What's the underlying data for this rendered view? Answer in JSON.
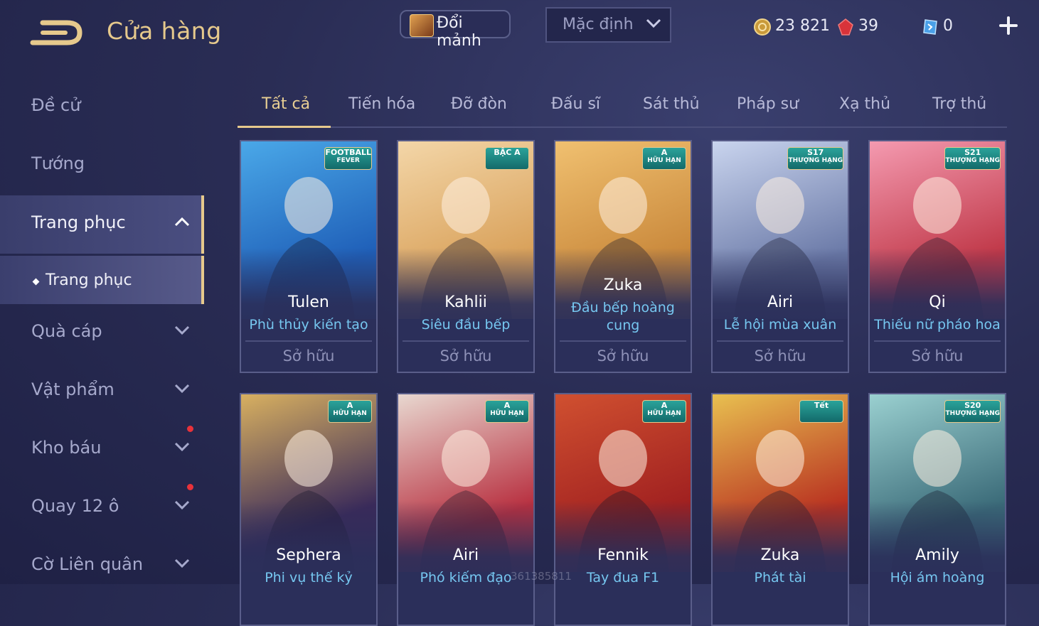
{
  "header": {
    "title": "Cửa hàng",
    "exchange_label": "Đổi mảnh",
    "sort_label": "Mặc định",
    "currencies": [
      {
        "icon": "gold-coin-icon",
        "value": "23 821"
      },
      {
        "icon": "red-gem-icon",
        "value": "39"
      },
      {
        "icon": "blue-voucher-icon",
        "value": "0"
      }
    ]
  },
  "sidebar": {
    "items": [
      {
        "label": "Đề cử"
      },
      {
        "label": "Tướng"
      },
      {
        "label": "Trang phục"
      },
      {
        "label": "Trang phục"
      },
      {
        "label": "Quà cáp"
      },
      {
        "label": "Vật phẩm"
      },
      {
        "label": "Kho báu"
      },
      {
        "label": "Quay 12 ô"
      },
      {
        "label": "Cờ Liên quân"
      }
    ]
  },
  "tabs": [
    "Tất cả",
    "Tiến hóa",
    "Đỡ đòn",
    "Đấu sĩ",
    "Sát thủ",
    "Pháp sư",
    "Xạ thủ",
    "Trợ thủ"
  ],
  "cards": [
    {
      "hero": "Tulen",
      "skin": "Phù thủy kiến tạo",
      "status": "Sở hữu",
      "badge_top": "FOOTBALL",
      "badge_bottom": "FEVER",
      "art_colors": [
        "#1f5fb8",
        "#4aa8e8"
      ]
    },
    {
      "hero": "Kahlii",
      "skin": "Siêu đầu bếp",
      "status": "Sở hữu",
      "badge_top": "BẬC A",
      "badge_bottom": "",
      "art_colors": [
        "#d9a15a",
        "#f3d6a8"
      ]
    },
    {
      "hero": "Zuka",
      "skin": "Đầu bếp hoàng cung",
      "status": "Sở hữu",
      "badge_top": "A",
      "badge_bottom": "HỮU HẠN",
      "art_colors": [
        "#c9883b",
        "#f0c070"
      ]
    },
    {
      "hero": "Airi",
      "skin": "Lễ hội mùa xuân",
      "status": "Sở hữu",
      "badge_top": "S17",
      "badge_bottom": "THƯỢNG HẠNG",
      "art_colors": [
        "#6b7aa8",
        "#c9d4ee"
      ]
    },
    {
      "hero": "Qi",
      "skin": "Thiếu nữ pháo hoa",
      "status": "Sở hữu",
      "badge_top": "S21",
      "badge_bottom": "THƯỢNG HẠNG",
      "art_colors": [
        "#c03848",
        "#f49ab0"
      ]
    },
    {
      "hero": "Sephera",
      "skin": "Phi vụ thế kỷ",
      "status": "",
      "badge_top": "A",
      "badge_bottom": "HỮU HẠN",
      "art_colors": [
        "#3a2a5a",
        "#d8b060"
      ]
    },
    {
      "hero": "Airi",
      "skin": "Phó kiếm đạo",
      "status": "",
      "badge_top": "A",
      "badge_bottom": "HỮU HẠN",
      "art_colors": [
        "#b83040",
        "#e8d8d0"
      ]
    },
    {
      "hero": "Fennik",
      "skin": "Tay đua F1",
      "status": "",
      "badge_top": "A",
      "badge_bottom": "HỮU HẠN",
      "art_colors": [
        "#a02020",
        "#d05030"
      ]
    },
    {
      "hero": "Zuka",
      "skin": "Phát tài",
      "status": "",
      "badge_top": "Tết",
      "badge_bottom": "",
      "art_colors": [
        "#b83020",
        "#e8c050"
      ]
    },
    {
      "hero": "Amily",
      "skin": "Hội ám hoàng",
      "status": "",
      "badge_top": "S20",
      "badge_bottom": "THƯỢNG HẠNG",
      "art_colors": [
        "#3a6a78",
        "#9ad0d0"
      ]
    }
  ],
  "watermark": "361385811",
  "colors": {
    "accent_gold": "#e6c98c",
    "skin_blue": "#76c7f0",
    "notify_red": "#e8323a"
  }
}
